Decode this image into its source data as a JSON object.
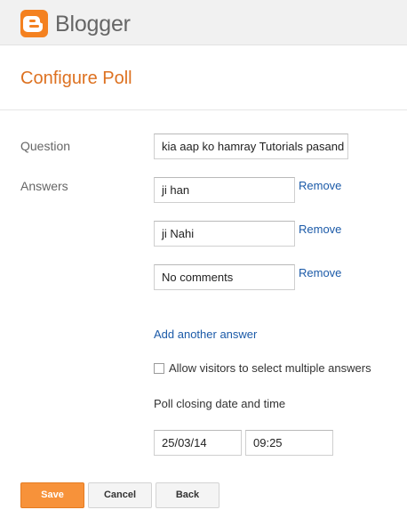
{
  "header": {
    "brand": "Blogger",
    "logo_icon": "blogger-logo-icon",
    "brand_color": "#f48120"
  },
  "page": {
    "title": "Configure Poll",
    "title_color": "#dd7120"
  },
  "form": {
    "question_label": "Question",
    "question_value": "kia aap ko hamray Tutorials pasand",
    "answers_label": "Answers",
    "answers": [
      {
        "value": "ji han",
        "remove_label": "Remove"
      },
      {
        "value": "ji Nahi",
        "remove_label": "Remove"
      },
      {
        "value": "No comments",
        "remove_label": "Remove"
      }
    ],
    "add_answer_label": "Add another answer",
    "multiple_answers_label": "Allow visitors to select multiple answers",
    "multiple_answers_checked": false,
    "closing_label": "Poll closing date and time",
    "closing_date": "25/03/14",
    "closing_time": "09:25",
    "link_color": "#1b5aa8"
  },
  "buttons": {
    "save": "Save",
    "cancel": "Cancel",
    "back": "Back",
    "save_color": "#f7923a"
  }
}
